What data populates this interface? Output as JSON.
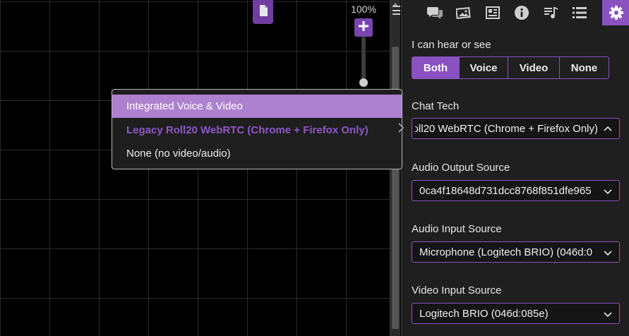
{
  "canvas": {
    "zoom_label": "100%",
    "page_icon": "page-icon",
    "zoom_in_icon": "plus-icon",
    "menu_icon": "hamburger-icon"
  },
  "sidebar": {
    "tabs": [
      {
        "name": "chat",
        "icon": "chat-bubbles-icon"
      },
      {
        "name": "art",
        "icon": "image-library-icon"
      },
      {
        "name": "journal",
        "icon": "journal-icon"
      },
      {
        "name": "compendium",
        "icon": "info-icon"
      },
      {
        "name": "jukebox",
        "icon": "music-icon"
      },
      {
        "name": "collections",
        "icon": "list-icon"
      },
      {
        "name": "settings",
        "icon": "gear-icon",
        "active": true
      }
    ],
    "hear_see": {
      "label": "I can hear or see",
      "options": [
        "Both",
        "Voice",
        "Video",
        "None"
      ],
      "selected": "Both"
    },
    "chat_tech": {
      "label": "Chat Tech",
      "value": "Legacy Roll20 WebRTC (Chrome + Firefox Only)"
    },
    "audio_output": {
      "label": "Audio Output Source",
      "value": "0ca4f18648d731dcc8768f851dfe965"
    },
    "audio_input": {
      "label": "Audio Input Source",
      "value": "Microphone (Logitech BRIO) (046d:0"
    },
    "video_input": {
      "label": "Video Input Source",
      "value": "Logitech BRIO (046d:085e)"
    }
  },
  "dropdown": {
    "options": [
      {
        "label": "Integrated Voice & Video",
        "state": "highlighted"
      },
      {
        "label": "Legacy Roll20 WebRTC (Chrome + Firefox Only)",
        "state": "selected"
      },
      {
        "label": "None (no video/audio)",
        "state": "normal"
      }
    ]
  },
  "colors": {
    "accent": "#8a52c0",
    "highlight": "#ad81cf",
    "panel_bg": "#1f1f1f",
    "canvas_bg": "#000000"
  }
}
